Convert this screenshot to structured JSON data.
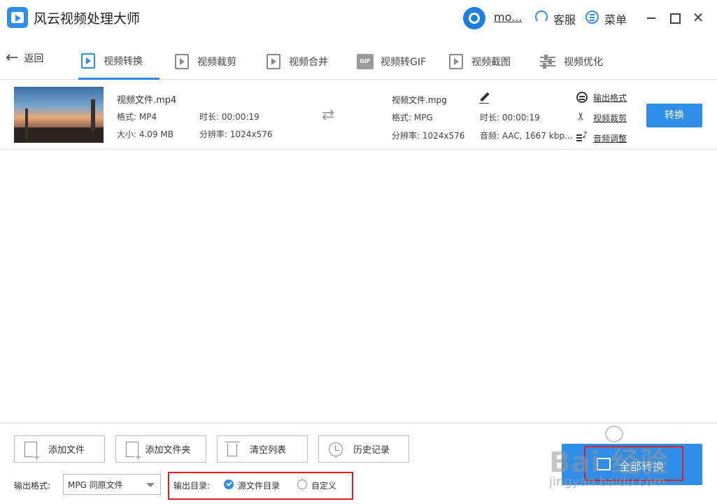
{
  "app": {
    "title": "风云视频处理大师",
    "user_name": "mo...",
    "service_label": "客服",
    "menu_label": "菜单"
  },
  "nav": {
    "back_label": "返回",
    "tabs": [
      {
        "label": "视频转换",
        "active": true
      },
      {
        "label": "视频裁剪",
        "active": false
      },
      {
        "label": "视频合并",
        "active": false
      },
      {
        "label": "视频转GIF",
        "active": false
      },
      {
        "label": "视频截图",
        "active": false
      },
      {
        "label": "视频优化",
        "active": false
      }
    ],
    "gif_badge": "GIF"
  },
  "file": {
    "source": {
      "name": "视频文件.mp4",
      "format": "格式: MP4",
      "duration": "时长: 00:00:19",
      "size": "大小: 4.09 MB",
      "resolution": "分辨率: 1024x576"
    },
    "output": {
      "name": "视频文件.mpg",
      "format": "格式: MPG",
      "duration": "时长: 00:00:19",
      "resolution": "分辨率: 1024x576",
      "audio": "音频: AAC, 1667 kbp..."
    },
    "links": {
      "output_format": "输出格式",
      "video_cut": "视频裁剪",
      "audio_adjust": "音频调整"
    },
    "convert_label": "转换"
  },
  "bottom": {
    "add_file": "添加文件",
    "add_folder": "添加文件夹",
    "clear_list": "清空列表",
    "history": "历史记录",
    "format_label": "输出格式:",
    "format_value": "MPG 同原文件",
    "outdir_label": "输出目录:",
    "outdir_source": "源文件目录",
    "outdir_custom": "自定义",
    "convert_all": "全部转换"
  },
  "watermark": {
    "brand": "Bai 经验",
    "url": "jingyan.baidu.com"
  },
  "colors": {
    "accent": "#2f8ee8",
    "highlight": "#e02020"
  }
}
